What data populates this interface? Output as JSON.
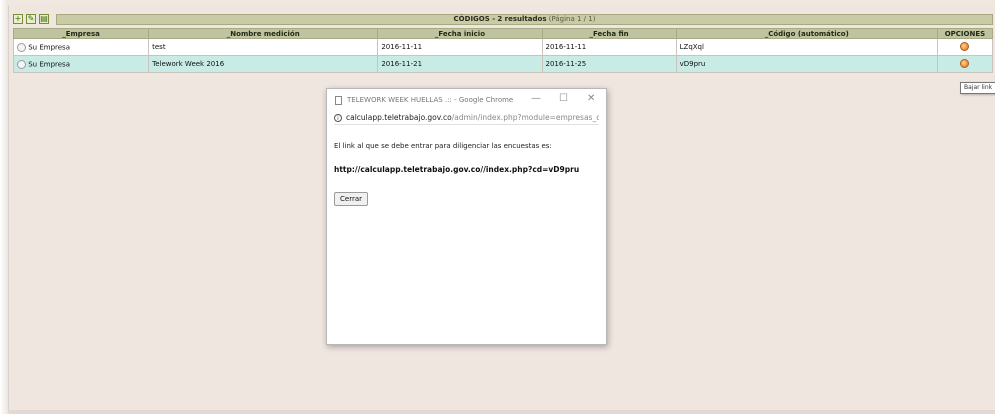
{
  "toolbar": {
    "icons": [
      "add-icon",
      "edit-icon",
      "export-icon"
    ]
  },
  "caption": {
    "title": "CÓDIGOS -",
    "count": "2 resultados",
    "page": "(Página 1 / 1)"
  },
  "table": {
    "columns": [
      "_Empresa",
      "_Nombre medición",
      "_Fecha inicio",
      "_Fecha fin",
      "_Código (automático)",
      "OPCIONES"
    ],
    "rows": [
      {
        "empresa": "Su Empresa",
        "nombre": "test",
        "inicio": "2016-11-11",
        "fin": "2016-11-11",
        "codigo": "LZqXql"
      },
      {
        "empresa": "Su Empresa",
        "nombre": "Telework Week 2016",
        "inicio": "2016-11-21",
        "fin": "2016-11-25",
        "codigo": "vD9pru"
      }
    ]
  },
  "tooltip": {
    "text": "Bajar link"
  },
  "popup": {
    "window_title": "TELEWORK WEEK HUELLAS .:: - Google Chrome",
    "address_host": "calculapp.teletrabajo.gov.co",
    "address_path": "/admin/index.php?module=empresas_c",
    "message": "El link al que se debe entrar para diligenciar las encuestas es:",
    "link": "http://calculapp.teletrabajo.gov.co//index.php?cd=vD9pru",
    "close_label": "Cerrar",
    "win_minimize": "—",
    "win_maximize": "☐",
    "win_close": "✕"
  },
  "colors": {
    "background": "#f1e7e1",
    "header": "#c0c3a0",
    "row_highlight": "#c9ebe5"
  }
}
